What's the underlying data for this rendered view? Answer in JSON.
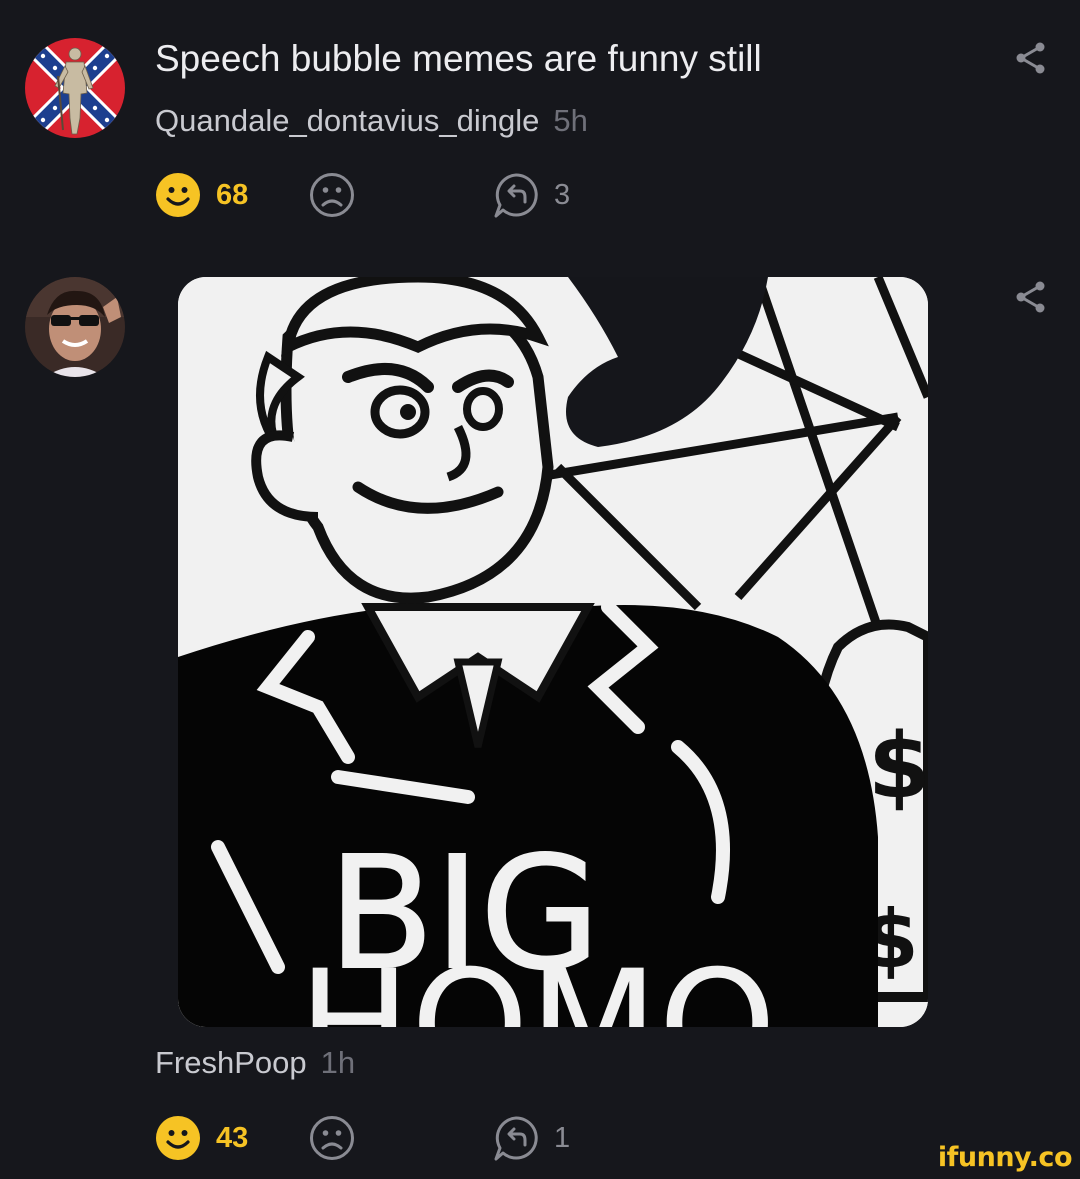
{
  "comments": [
    {
      "text": "Speech bubble memes are funny still",
      "username": "Quandale_dontavius_dingle",
      "time": "5h",
      "smile_count": "68",
      "reply_count": "3",
      "avatar_icon": "confederate-flag-avatar"
    },
    {
      "username": "FreshPoop",
      "time": "1h",
      "smile_count": "43",
      "reply_count": "1",
      "avatar_icon": "sunglasses-man-avatar",
      "attachment": {
        "type": "image",
        "caption_text": "BIG",
        "partial_text": "HOMO"
      }
    }
  ],
  "watermark": "ifunny.co",
  "colors": {
    "background": "#16171c",
    "smile_accent": "#f6c324",
    "icon_gray": "#8a8b93"
  }
}
